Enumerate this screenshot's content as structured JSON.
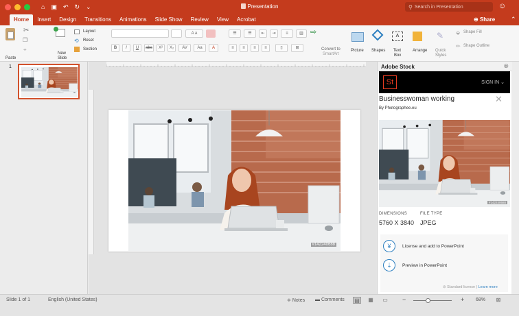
{
  "window": {
    "title": "Presentation",
    "search_placeholder": "Search in Presentation",
    "share_label": "Share"
  },
  "tabs": [
    "Home",
    "Insert",
    "Design",
    "Transitions",
    "Animations",
    "Slide Show",
    "Review",
    "View",
    "Acrobat"
  ],
  "active_tab": "Home",
  "ribbon": {
    "paste": "Paste",
    "new_slide_1": "New",
    "new_slide_2": "Slide",
    "layout": "Layout",
    "reset": "Reset",
    "section": "Section",
    "convert_1": "Convert to",
    "convert_2": "SmartArt",
    "picture": "Picture",
    "shapes": "Shapes",
    "text_box_1": "Text",
    "text_box_2": "Box",
    "arrange": "Arrange",
    "quick_styles_1": "Quick",
    "quick_styles_2": "Styles",
    "shape_fill": "Shape Fill",
    "shape_outline": "Shape Outline",
    "font_bold": "B",
    "font_italic": "I",
    "font_underline": "U",
    "font_strike": "abc",
    "superscript": "X²",
    "subscript": "X₂",
    "font_grow": "A",
    "font_shrink": "A"
  },
  "slides": {
    "current_number": "1"
  },
  "slide_image": {
    "asset_id": "#142240688"
  },
  "stock": {
    "panel_title": "Adobe Stock",
    "logo": "St",
    "sign_in": "SIGN IN",
    "asset_title": "Businesswoman working",
    "asset_by": "By Photographee.eu",
    "asset_id": "#142240688",
    "dimensions_label": "DIMENSIONS",
    "dimensions_value": "5760 X 3840",
    "filetype_label": "FILE TYPE",
    "filetype_value": "JPEG",
    "action_license": "License and add to PowerPoint",
    "action_preview": "Preview in PowerPoint",
    "license_text": "Standard license",
    "learn_more": "Learn more"
  },
  "status": {
    "slide_count": "Slide 1 of 1",
    "language": "English (United States)",
    "notes": "Notes",
    "comments": "Comments",
    "zoom_minus": "−",
    "zoom_plus": "+",
    "zoom_level": "68%",
    "zoom_fraction": 0.4
  },
  "colors": {
    "brand": "#c43b1d",
    "stock_red": "#e63b20",
    "link_blue": "#2d7fc0"
  }
}
